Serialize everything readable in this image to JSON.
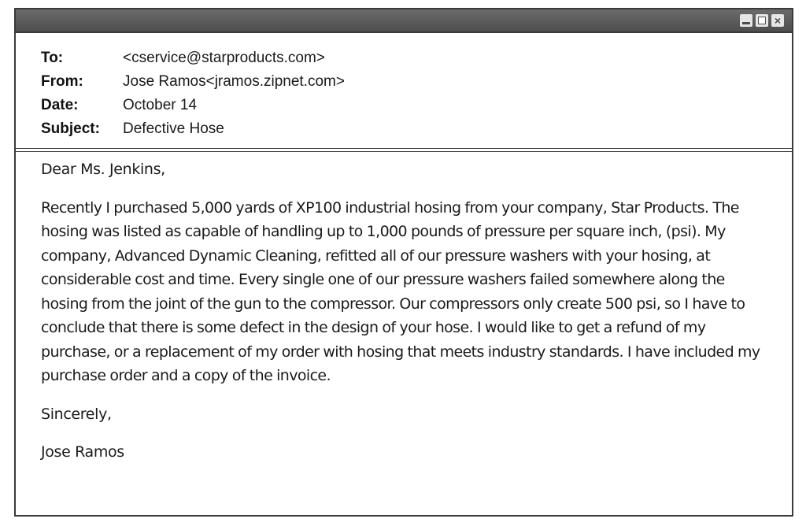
{
  "window": {
    "controls": {
      "minimize_icon": "minimize-icon",
      "maximize_icon": "maximize-icon",
      "close_icon": "close-icon",
      "close_glyph": "×"
    }
  },
  "email": {
    "header": {
      "to_label": "To:",
      "to_value": "<cservice@starproducts.com>",
      "from_label": "From:",
      "from_value": "Jose Ramos<jramos.zipnet.com>",
      "date_label": "Date:",
      "date_value": "October 14",
      "subject_label": "Subject:",
      "subject_value": "Defective Hose"
    },
    "body": {
      "greeting": "Dear Ms. Jenkins,",
      "paragraph": "Recently I purchased 5,000 yards of XP100 industrial hosing from your company, Star Products. The hosing was listed as capable of handling up to 1,000 pounds of pressure per square inch, (psi). My company, Advanced Dynamic Cleaning, refitted all of our pressure washers with your hosing, at considerable cost and time. Every single one of our pressure washers failed somewhere along the hosing from the joint of the gun to the compressor. Our compressors only create 500 psi, so I have to conclude that there is some defect in the design of your hose. I would like to get a refund of my purchase, or a replacement of my order with hosing that meets industry standards. I have included my purchase order and a copy of the invoice.",
      "closing": "Sincerely,",
      "signature": "Jose Ramos"
    }
  }
}
